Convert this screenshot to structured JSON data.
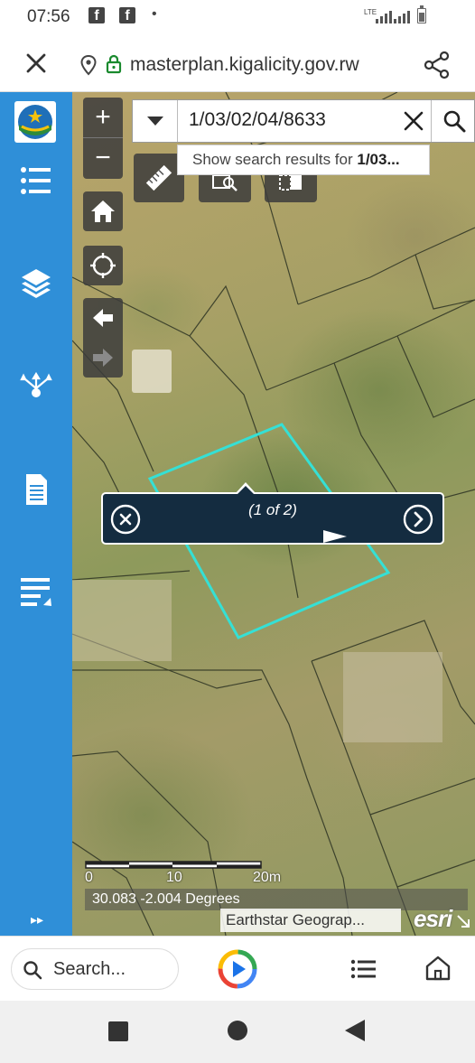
{
  "status_bar": {
    "time": "07:56",
    "lte": "LTE"
  },
  "browser": {
    "url": "masterplan.kigalicity.gov.rw"
  },
  "map_search": {
    "query": "1/03/02/04/8633",
    "suggestion_prefix": "Show search results for ",
    "suggestion_term": "1/03..."
  },
  "popup": {
    "title": "(1 of 2)"
  },
  "scale_bar": {
    "labels": [
      "0",
      "10",
      "20m"
    ]
  },
  "coordinates": "30.083 -2.004 Degrees",
  "attribution": "Earthstar Geograp...",
  "esri_logo": "esri",
  "bottom_bar": {
    "search_placeholder": "Search..."
  },
  "colors": {
    "rail": "#2f8fd8",
    "parcel_highlight": "#35e0d5",
    "popup_bg": "#142c40"
  }
}
